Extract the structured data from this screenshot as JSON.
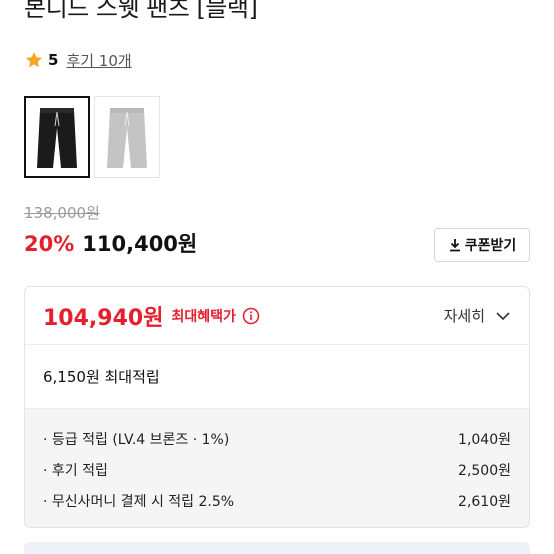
{
  "product": {
    "title": "본디드 스웻 팬츠 [블랙]",
    "rating": "5",
    "review_link": "후기 10개"
  },
  "thumbnails": [
    {
      "color": "black",
      "selected": true
    },
    {
      "color": "gray",
      "selected": false
    }
  ],
  "price": {
    "original": "138,000원",
    "discount": "20%",
    "sale": "110,400원",
    "coupon_button": "쿠폰받기"
  },
  "benefit": {
    "max_price": "104,940원",
    "max_label": "최대혜택가",
    "detail_toggle": "자세히",
    "points_summary": "6,150원 최대적립",
    "points": [
      {
        "label": "· 등급 적립 (LV.4 브론즈 · 1%)",
        "amount": "1,040원"
      },
      {
        "label": "· 후기 적립",
        "amount": "2,500원"
      },
      {
        "label": "· 무신사머니 결제 시 적립 2.5%",
        "amount": "2,610원"
      }
    ]
  },
  "colors": {
    "accent_red": "#e5202e",
    "star": "#f5a623"
  }
}
